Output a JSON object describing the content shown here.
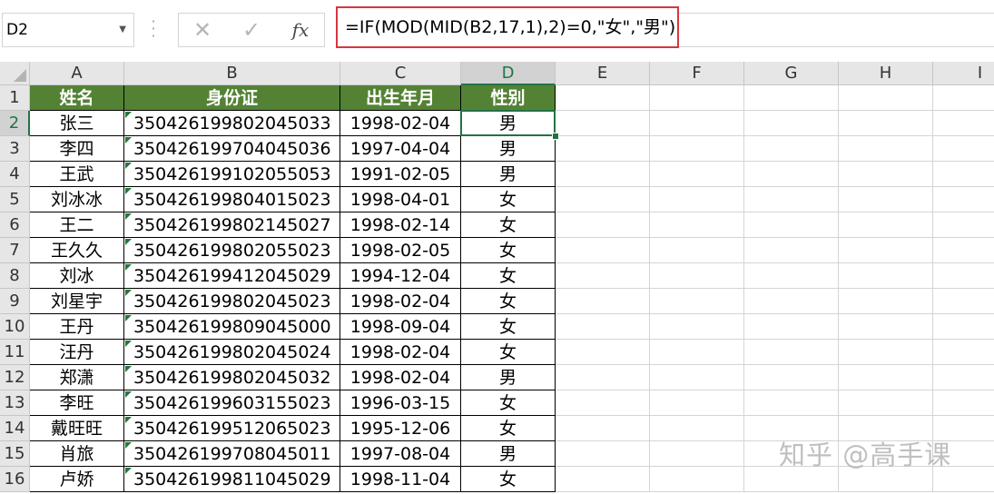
{
  "namebox": {
    "value": "D2",
    "dropdown_icon": "chevron-down-icon"
  },
  "formula_bar": {
    "cancel_glyph": "✕",
    "enter_glyph": "✓",
    "function_glyph": "fx",
    "formula": "=IF(MOD(MID(B2,17,1),2)=0,\"女\",\"男\")",
    "highlight_color": "#d9363e"
  },
  "columns": [
    "A",
    "B",
    "C",
    "D",
    "E",
    "F",
    "G",
    "H",
    "I"
  ],
  "selected_column": "D",
  "selected_row": "2",
  "header_fill_color": "#548235",
  "table": {
    "headers": [
      "姓名",
      "身份证",
      "出生年月",
      "性别"
    ],
    "rows": [
      {
        "row": "2",
        "name": "张三",
        "id": "350426199802045033",
        "birth": "1998-02-04",
        "gender": "男"
      },
      {
        "row": "3",
        "name": "李四",
        "id": "350426199704045036",
        "birth": "1997-04-04",
        "gender": "男"
      },
      {
        "row": "4",
        "name": "王武",
        "id": "350426199102055053",
        "birth": "1991-02-05",
        "gender": "男"
      },
      {
        "row": "5",
        "name": "刘冰冰",
        "id": "350426199804015023",
        "birth": "1998-04-01",
        "gender": "女"
      },
      {
        "row": "6",
        "name": "王二",
        "id": "350426199802145027",
        "birth": "1998-02-14",
        "gender": "女"
      },
      {
        "row": "7",
        "name": "王久久",
        "id": "350426199802055023",
        "birth": "1998-02-05",
        "gender": "女"
      },
      {
        "row": "8",
        "name": "刘冰",
        "id": "350426199412045029",
        "birth": "1994-12-04",
        "gender": "女"
      },
      {
        "row": "9",
        "name": "刘星宇",
        "id": "350426199802045023",
        "birth": "1998-02-04",
        "gender": "女"
      },
      {
        "row": "10",
        "name": "王丹",
        "id": "350426199809045000",
        "birth": "1998-09-04",
        "gender": "女"
      },
      {
        "row": "11",
        "name": "汪丹",
        "id": "350426199802045024",
        "birth": "1998-02-04",
        "gender": "女"
      },
      {
        "row": "12",
        "name": "郑潇",
        "id": "350426199802045032",
        "birth": "1998-02-04",
        "gender": "男"
      },
      {
        "row": "13",
        "name": "李旺",
        "id": "350426199603155023",
        "birth": "1996-03-15",
        "gender": "女"
      },
      {
        "row": "14",
        "name": "戴旺旺",
        "id": "350426199512065023",
        "birth": "1995-12-06",
        "gender": "女"
      },
      {
        "row": "15",
        "name": "肖旅",
        "id": "350426199708045011",
        "birth": "1997-08-04",
        "gender": "男"
      },
      {
        "row": "16",
        "name": "卢娇",
        "id": "350426199811045029",
        "birth": "1998-11-04",
        "gender": "女"
      }
    ]
  },
  "watermark": "知乎 @高手课"
}
